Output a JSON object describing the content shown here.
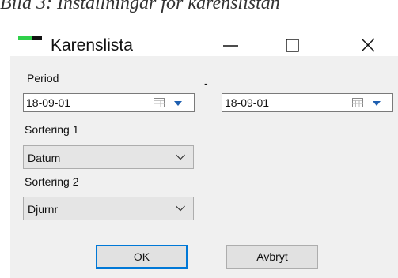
{
  "caption": "Bild 3: Inställningar för karenslistan",
  "window": {
    "title": "Karenslista",
    "controls": {
      "minimize": "—",
      "maximize": "☐",
      "close": "✕"
    },
    "icon": "app-icon",
    "icon_colors": [
      "#2fd04a",
      "#111111"
    ]
  },
  "form": {
    "period_label": "Period",
    "period_separator": "-",
    "date_from": "18-09-01",
    "date_to": "18-09-01",
    "sort1_label": "Sortering 1",
    "sort1_value": "Datum",
    "sort2_label": "Sortering 2",
    "sort2_value": "Djurnr"
  },
  "buttons": {
    "ok": "OK",
    "cancel": "Avbryt"
  },
  "colors": {
    "accent": "#0078d7",
    "dialog_bg": "#f0f0f0"
  }
}
